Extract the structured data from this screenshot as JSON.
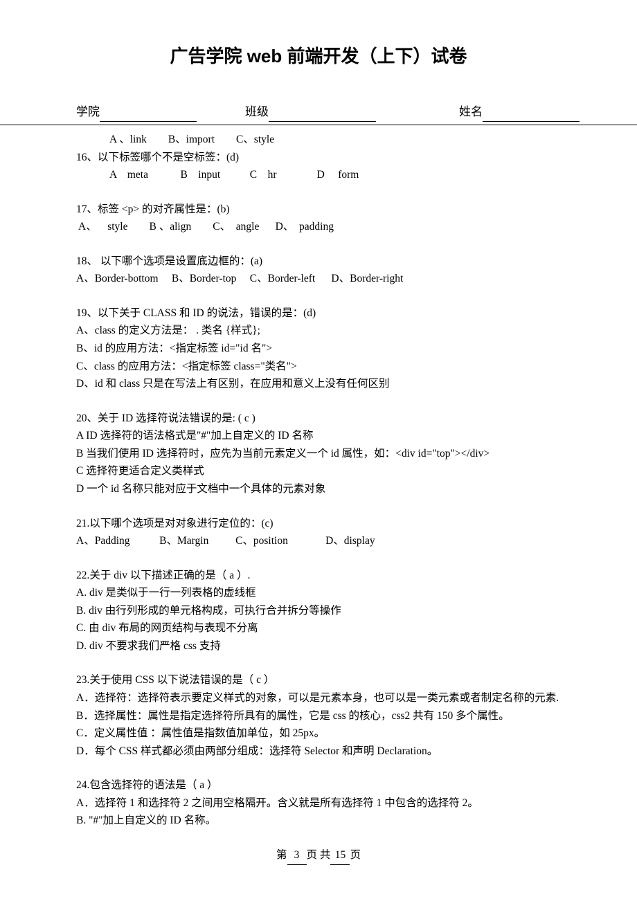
{
  "title": "广告学院 web 前端开发（上下）试卷",
  "fields": {
    "school_label": "学院",
    "class_label": "班级",
    "name_label": "姓名"
  },
  "q15_opts": "A 、link        B、import        C、style",
  "q16": {
    "stem": "16、以下标签哪个不是空标签：(d)",
    "opts": "A    meta            B    input           C    hr               D     form"
  },
  "q17": {
    "stem": "17、标签 <p> 的对齐属性是：(b)",
    "opts": " A、    style        B 、align        C、  angle      D、  padding"
  },
  "q18": {
    "stem": "18、   以下哪个选项是设置底边框的：(a)",
    "opts": "A、Border-bottom     B、Border-top     C、Border-left      D、Border-right"
  },
  "q19": {
    "stem": "19、以下关于 CLASS 和 ID 的说法，错误的是：(d)",
    "a": "A、class 的定义方法是：  . 类名  {样式};",
    "b": "B、id 的应用方法：<指定标签  id=\"id 名\">",
    "c": "C、class 的应用方法：<指定标签  class=\"类名\">",
    "d": "D、id 和 class 只是在写法上有区别，在应用和意义上没有任何区别"
  },
  "q20": {
    "stem": "20、关于 ID 选择符说法错误的是: ( c )",
    "a": "A    ID 选择符的语法格式是\"#\"加上自定义的 ID 名称",
    "b": "B    当我们使用 ID 选择符时，应先为当前元素定义一个 id 属性，如：<div    id=\"top\"></div>",
    "c": "C    选择符更适合定义类样式",
    "d": "D  一个 id 名称只能对应于文档中一个具体的元素对象"
  },
  "q21": {
    "stem": "21.以下哪个选项是对对象进行定位的：(c)",
    "opts": "A、Padding           B、Margin          C、position              D、display"
  },
  "q22": {
    "stem": "22.关于 div 以下描述正确的是（      a       ）.",
    "a": "A. div 是类似于一行一列表格的虚线框",
    "b": "B. div 由行列形成的单元格构成，可执行合并拆分等操作",
    "c": "C.  由 div 布局的网页结构与表现不分离",
    "d": "D. div 不要求我们严格 css 支持"
  },
  "q23": {
    "stem": "23.关于使用 CSS 以下说法错误的是（      c        ）",
    "a": "A．选择符：选择符表示要定义样式的对象，可以是元素本身，也可以是一类元素或者制定名称的元素.",
    "b": "B．选择属性：属性是指定选择符所具有的属性，它是 css 的核心，css2 共有 150 多个属性。",
    "c": "C．定义属性值 ：属性值是指数值加单位，如 25px。",
    "d": "D．每个 CSS 样式都必须由两部分组成：选择符 Selector 和声明 Declaration。"
  },
  "q24": {
    "stem": "24.包含选择符的语法是（      a        ）",
    "a": "A．选择符 1 和选择符 2 之间用空格隔开。含义就是所有选择符 1 中包含的选择符 2。",
    "b": "B. \"#\"加上自定义的 ID 名称。"
  },
  "footer": {
    "p1": "第",
    "n1": "3",
    "p2": "页 共",
    "n2": "15",
    "p3": "页"
  }
}
